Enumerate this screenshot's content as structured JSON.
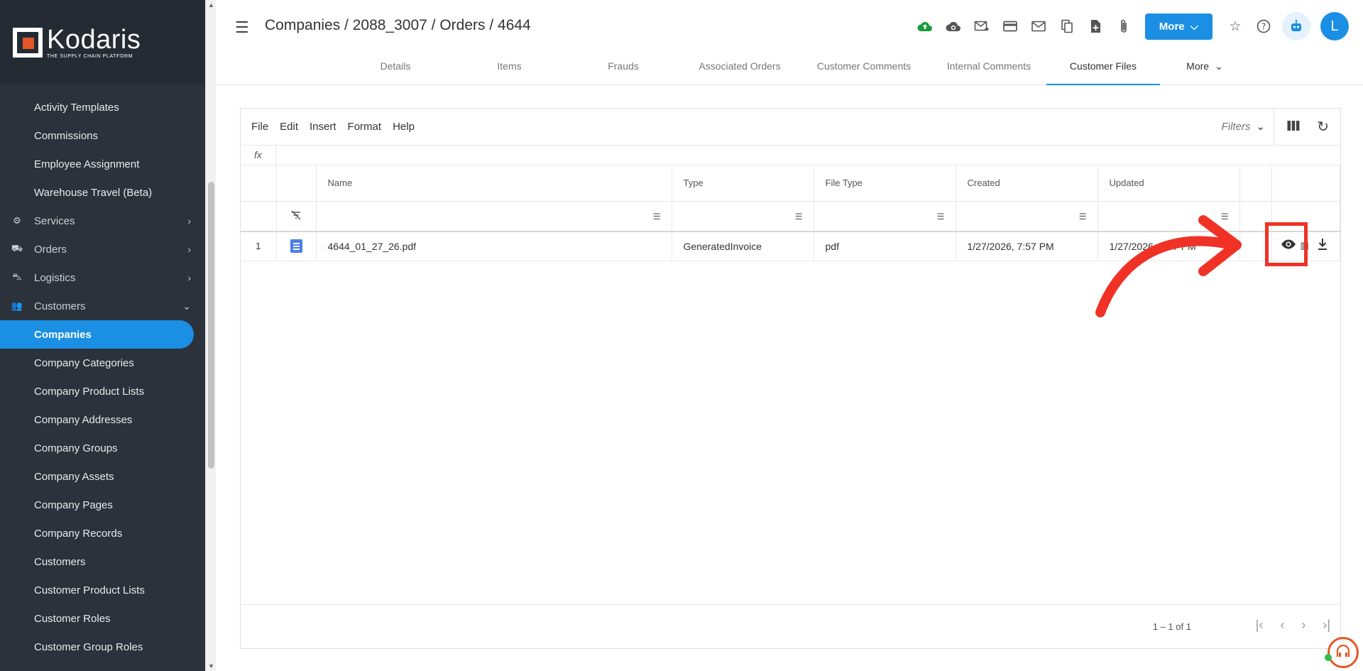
{
  "brand": {
    "name": "Kodaris",
    "tagline": "THE SUPPLY CHAIN PLATFORM"
  },
  "sidebar": {
    "items": [
      {
        "label": "Activity Templates",
        "type": "item"
      },
      {
        "label": "Commissions",
        "type": "item"
      },
      {
        "label": "Employee Assignment",
        "type": "item"
      },
      {
        "label": "Warehouse Travel (Beta)",
        "type": "item"
      },
      {
        "label": "Services",
        "type": "group",
        "icon": "services-icon",
        "chevron": "›"
      },
      {
        "label": "Orders",
        "type": "group",
        "icon": "truck-icon",
        "chevron": "›"
      },
      {
        "label": "Logistics",
        "type": "group",
        "icon": "shipping-icon",
        "chevron": "›"
      },
      {
        "label": "Customers",
        "type": "group",
        "icon": "people-icon",
        "chevron": "⌄"
      },
      {
        "label": "Companies",
        "type": "item",
        "active": true
      },
      {
        "label": "Company Categories",
        "type": "item"
      },
      {
        "label": "Company Product Lists",
        "type": "item"
      },
      {
        "label": "Company Addresses",
        "type": "item"
      },
      {
        "label": "Company Groups",
        "type": "item"
      },
      {
        "label": "Company Assets",
        "type": "item"
      },
      {
        "label": "Company Pages",
        "type": "item"
      },
      {
        "label": "Company Records",
        "type": "item"
      },
      {
        "label": "Customers",
        "type": "item"
      },
      {
        "label": "Customer Product Lists",
        "type": "item"
      },
      {
        "label": "Customer Roles",
        "type": "item"
      },
      {
        "label": "Customer Group Roles",
        "type": "item"
      }
    ]
  },
  "header": {
    "breadcrumb": "Companies / 2088_3007 / Orders / 4644",
    "more_label": "More",
    "avatar_initial": "L",
    "toolbar_icons": [
      "cloud-upload-icon",
      "cloud-sync-icon",
      "email-forward-icon",
      "credit-card-icon",
      "email-icon",
      "copy-icon",
      "add-document-icon",
      "attachment-icon"
    ]
  },
  "tabs": [
    {
      "label": "Details"
    },
    {
      "label": "Items"
    },
    {
      "label": "Frauds"
    },
    {
      "label": "Associated Orders"
    },
    {
      "label": "Customer Comments"
    },
    {
      "label": "Internal Comments"
    },
    {
      "label": "Customer Files",
      "active": true
    },
    {
      "label": "More"
    }
  ],
  "sheet": {
    "menu": [
      "File",
      "Edit",
      "Insert",
      "Format",
      "Help"
    ],
    "filters_label": "Filters",
    "fx_label": "fx",
    "columns": [
      "Name",
      "Type",
      "File Type",
      "Created",
      "Updated"
    ],
    "rows": [
      {
        "num": "1",
        "name": "4644_01_27_26.pdf",
        "type": "GeneratedInvoice",
        "file_type": "pdf",
        "created": "1/27/2026, 7:57 PM",
        "updated": "1/27/2026, 7:57 PM"
      }
    ],
    "range": "1 – 1 of 1"
  },
  "colors": {
    "accent": "#1a8fe3",
    "sidebar": "#2b323b",
    "annotation": "#f03226",
    "brand_orange": "#e3572a"
  }
}
